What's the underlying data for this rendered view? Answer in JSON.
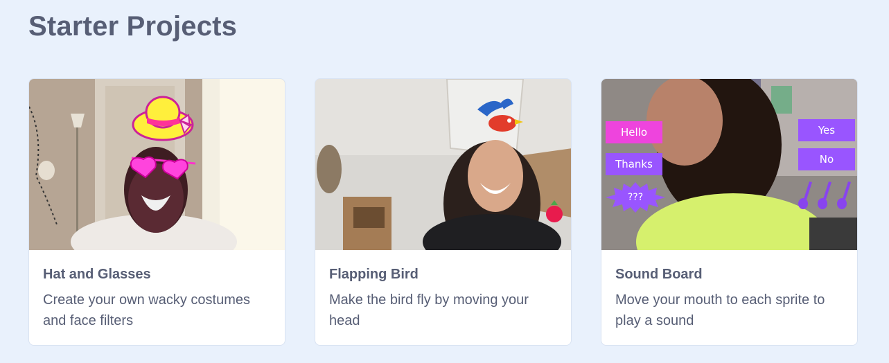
{
  "page": {
    "title": "Starter Projects"
  },
  "projects": [
    {
      "title": "Hat and Glasses",
      "description": "Create your own wacky costumes and face filters"
    },
    {
      "title": "Flapping Bird",
      "description": "Make the bird fly by moving your head"
    },
    {
      "title": "Sound Board",
      "description": "Move your mouth to each sprite to play a sound",
      "sprite_labels": [
        "Hello",
        "Thanks",
        "???",
        "Yes",
        "No"
      ]
    }
  ],
  "colors": {
    "background": "#e9f1fc",
    "text": "#575e75",
    "sprite_pink": "#ee44dd",
    "sprite_purple": "#9955ff"
  }
}
